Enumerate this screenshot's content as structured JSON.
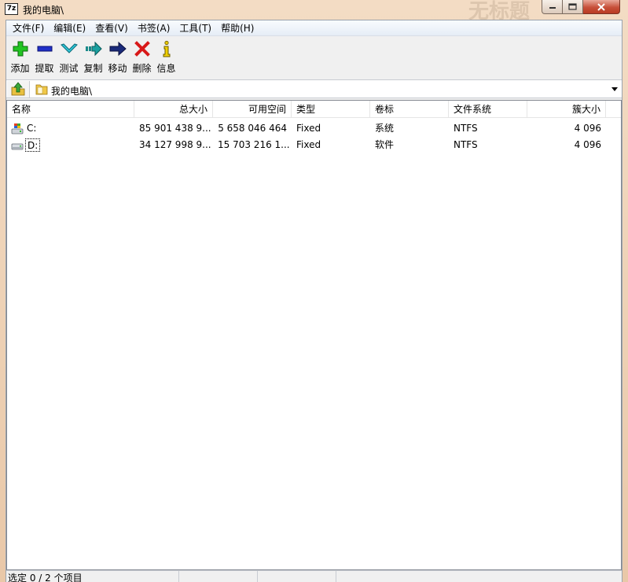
{
  "window": {
    "title": "我的电脑\\",
    "app_icon_text": "7z",
    "ghost_title": "无标题"
  },
  "menu": [
    "文件(F)",
    "编辑(E)",
    "查看(V)",
    "书签(A)",
    "工具(T)",
    "帮助(H)"
  ],
  "toolbar": [
    {
      "label": "添加",
      "icon": "add-icon"
    },
    {
      "label": "提取",
      "icon": "extract-icon"
    },
    {
      "label": "测试",
      "icon": "test-icon"
    },
    {
      "label": "复制",
      "icon": "copy-icon"
    },
    {
      "label": "移动",
      "icon": "move-icon"
    },
    {
      "label": "删除",
      "icon": "delete-icon"
    },
    {
      "label": "信息",
      "icon": "info-icon"
    }
  ],
  "address": {
    "path": "我的电脑\\"
  },
  "columns": [
    "名称",
    "总大小",
    "可用空间",
    "类型",
    "卷标",
    "文件系统",
    "簇大小"
  ],
  "rows": [
    {
      "name": "C:",
      "total": "85 901 438 9...",
      "free": "5 658 046 464",
      "type": "Fixed",
      "label": "系统",
      "fs": "NTFS",
      "cluster": "4 096",
      "icon": "system-drive-icon"
    },
    {
      "name": "D:",
      "total": "34 127 998 9...",
      "free": "15 703 216 1...",
      "type": "Fixed",
      "label": "软件",
      "fs": "NTFS",
      "cluster": "4 096",
      "icon": "hard-drive-icon"
    }
  ],
  "status": {
    "selection": "选定 0 / 2 个项目"
  },
  "colors": {
    "titlebar": "#e9c8a8",
    "close_button": "#c7503a",
    "menubar": "#e6edf6"
  }
}
